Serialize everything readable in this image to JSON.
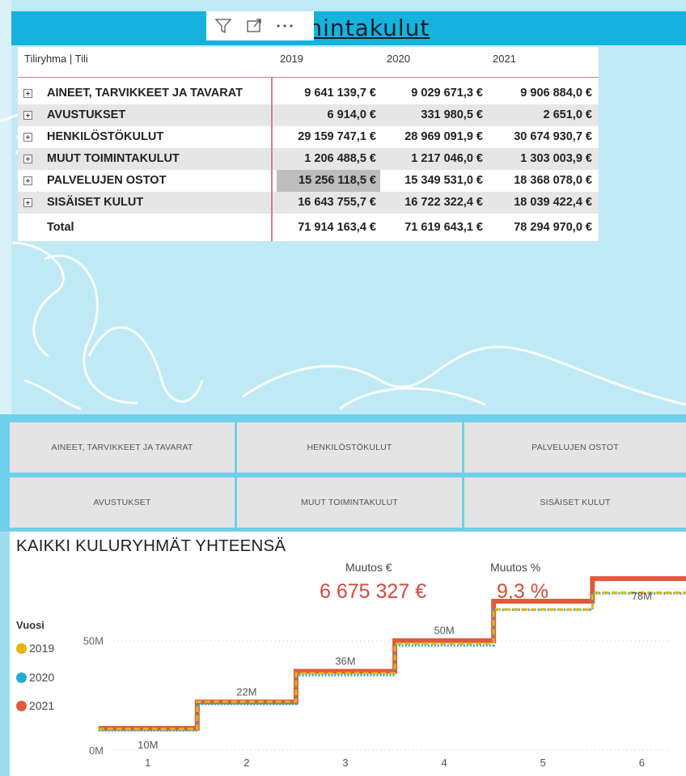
{
  "header": {
    "title": "Toimintakulut"
  },
  "toolbar": {
    "icons": [
      "filter-icon",
      "focus-mode-icon",
      "more-options-icon"
    ]
  },
  "matrix": {
    "columns": [
      "Tiliryhma | Tili",
      "2019",
      "2020",
      "2021"
    ],
    "rows": [
      {
        "label": "AINEET, TARVIKKEET JA TAVARAT",
        "v2019": "9 641 139,7 €",
        "v2020": "9 029 671,3 €",
        "v2021": "9 906 884,0 €"
      },
      {
        "label": "AVUSTUKSET",
        "v2019": "6 914,0 €",
        "v2020": "331 980,5 €",
        "v2021": "2 651,0 €"
      },
      {
        "label": "HENKILÖSTÖKULUT",
        "v2019": "29 159 747,1 €",
        "v2020": "28 969 091,9 €",
        "v2021": "30 674 930,7 €"
      },
      {
        "label": "MUUT TOIMINTAKULUT",
        "v2019": "1 206 488,5 €",
        "v2020": "1 217 046,0 €",
        "v2021": "1 303 003,9 €"
      },
      {
        "label": "PALVELUJEN OSTOT",
        "v2019": "15 256 118,5 €",
        "v2020": "15 349 531,0 €",
        "v2021": "18 368 078,0 €"
      },
      {
        "label": "SISÄISET KULUT",
        "v2019": "16 643 755,7 €",
        "v2020": "16 722 322,4 €",
        "v2021": "18 039 422,4 €"
      }
    ],
    "total": {
      "label": "Total",
      "v2019": "71 914 163,4 €",
      "v2020": "71 619 643,1 €",
      "v2021": "78 294 970,0 €"
    }
  },
  "slicer": {
    "buttons": [
      "AINEET, TARVIKKEET JA TAVARAT",
      "HENKILÖSTÖKULUT",
      "PALVELUJEN OSTOT",
      "AVUSTUKSET",
      "MUUT TOIMINTAKULUT",
      "SISÄISET KULUT"
    ]
  },
  "chart_panel": {
    "title": "KAIKKI KULURYHMÄT YHTEENSÄ",
    "kpi_change_eur_label": "Muutos €",
    "kpi_change_eur_value": "6 675 327 €",
    "kpi_change_pct_label": "Muutos %",
    "kpi_change_pct_value": "9,3 %",
    "legend_title": "Vuosi",
    "legend": [
      "2019",
      "2020",
      "2021"
    ]
  },
  "colors": {
    "title_bar": "#13b3de",
    "panel_bg": "#bfeaf5",
    "series_2019": "#e8b40c",
    "series_2020": "#22a9d6",
    "series_2021": "#e05a3c",
    "kpi": "#d24a3c"
  },
  "chart_data": {
    "type": "line",
    "step": true,
    "x": [
      1,
      2,
      3,
      4,
      5,
      6
    ],
    "series": [
      {
        "name": "2019",
        "values": [
          9.64,
          22.14,
          35.14,
          48.63,
          64.27,
          71.91
        ]
      },
      {
        "name": "2020",
        "values": [
          9.03,
          21.06,
          34.24,
          47.8,
          64.1,
          71.62
        ]
      },
      {
        "name": "2021",
        "values": [
          9.91,
          22.0,
          36.0,
          50.0,
          68.0,
          78.29
        ]
      }
    ],
    "data_labels": [
      "10M",
      "22M",
      "36M",
      "50M",
      "",
      "78M"
    ],
    "ytick_labels": [
      "0M",
      "50M"
    ],
    "yticks": [
      0,
      50
    ],
    "ylim": [
      0,
      85
    ],
    "xlim": [
      0.65,
      6.3
    ],
    "grid": true,
    "legend_position": "left"
  }
}
